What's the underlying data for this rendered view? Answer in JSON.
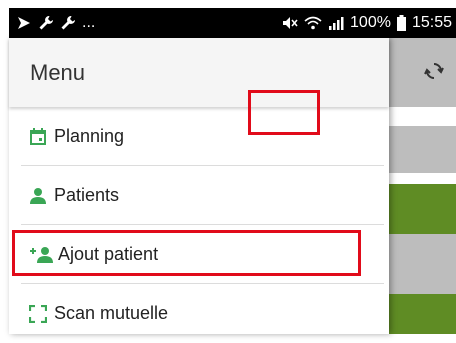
{
  "status_bar": {
    "left_icons": [
      "cast-icon",
      "wrench-icon",
      "wrench-icon",
      "ellipsis"
    ],
    "more": "...",
    "battery": "100%",
    "time": "15:55"
  },
  "drawer": {
    "title": "Menu",
    "items": [
      {
        "label": "Planning",
        "icon": "calendar-icon"
      },
      {
        "label": "Patients",
        "icon": "person-icon"
      },
      {
        "label": "Ajout patient",
        "icon": "add-person-icon"
      },
      {
        "label": "Scan mutuelle",
        "icon": "scan-frame-icon"
      }
    ]
  },
  "colors": {
    "accent_green": "#3aa655",
    "bg_green": "#5f8c24",
    "highlight_red": "#e10b1a",
    "gray_bg": "#bdbdbd"
  }
}
